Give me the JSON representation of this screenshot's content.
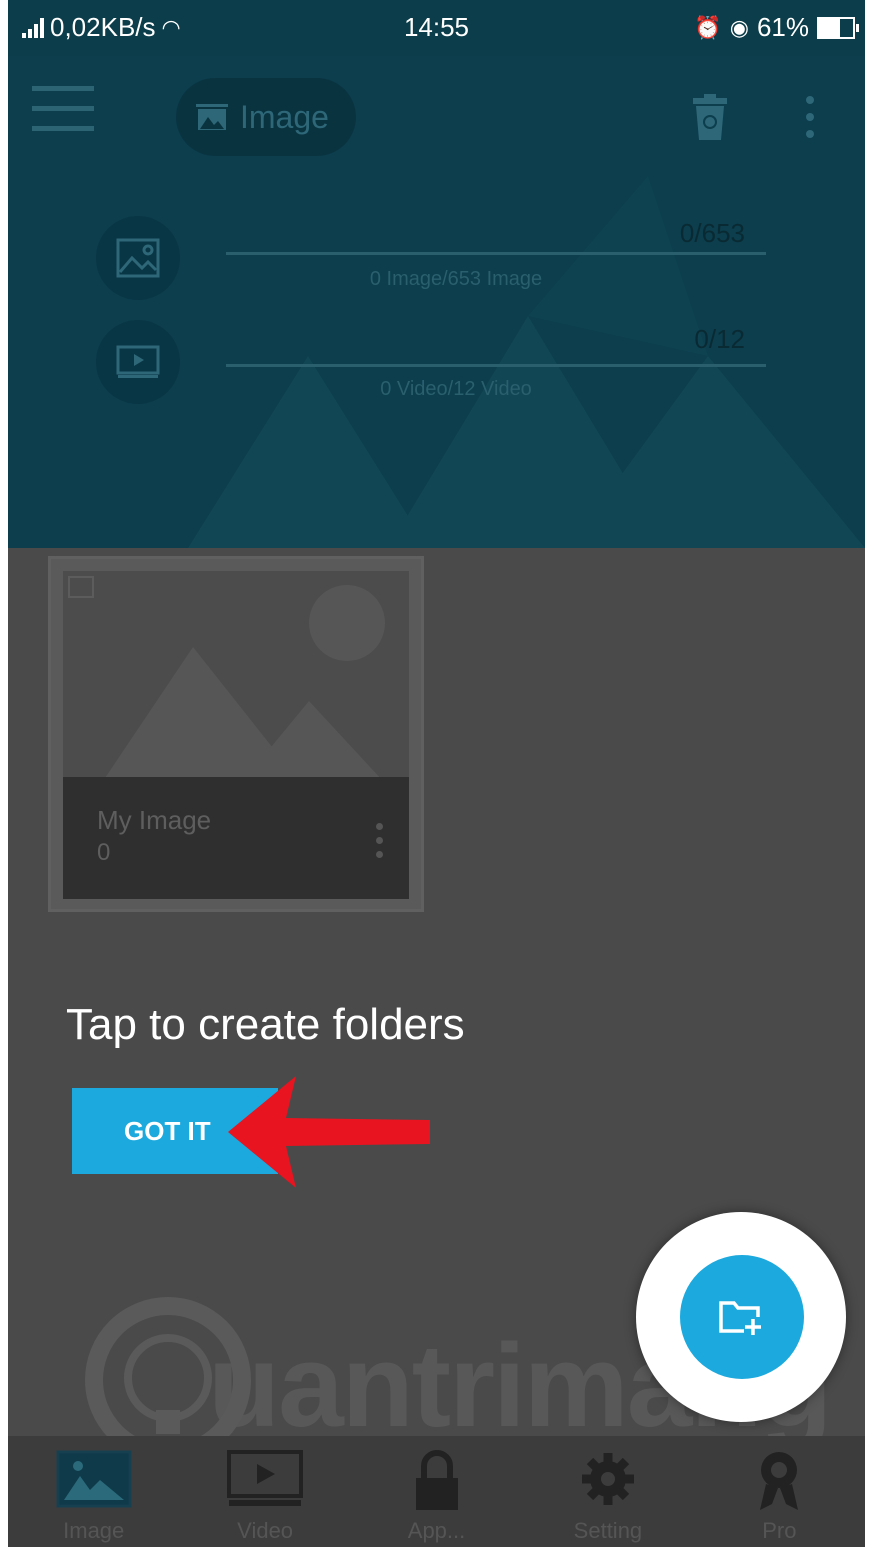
{
  "status_bar": {
    "network_speed": "0,02KB/s",
    "time": "14:55",
    "battery": "61%"
  },
  "header": {
    "title": "Image"
  },
  "stats": {
    "image_count": "0/653",
    "image_sub": "0 Image/653 Image",
    "video_count": "0/12",
    "video_sub": "0 Video/12 Video"
  },
  "folder": {
    "name": "My Image",
    "count": "0"
  },
  "tutorial": {
    "hint": "Tap to create folders",
    "button": "GOT IT"
  },
  "watermark": "uantrimang",
  "bottom_nav": {
    "items": [
      {
        "label": "Image",
        "icon": "image-icon"
      },
      {
        "label": "Video",
        "icon": "video-icon"
      },
      {
        "label": "App...",
        "icon": "lock-icon"
      },
      {
        "label": "Setting",
        "icon": "gear-icon"
      },
      {
        "label": "Pro",
        "icon": "badge-icon"
      }
    ]
  },
  "colors": {
    "accent": "#1ca9dd",
    "header_bg": "#0c3e4d",
    "overlay": "#4a4a4a",
    "arrow": "#e8141f"
  }
}
